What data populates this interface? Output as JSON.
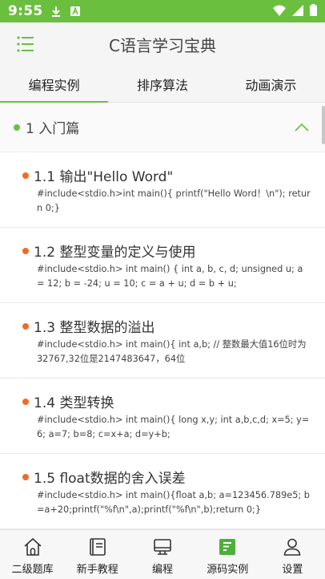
{
  "status_bar": {
    "time": "9:55"
  },
  "app": {
    "title": "C语言学习宝典"
  },
  "tabs": [
    {
      "label": "编程实例",
      "active": true
    },
    {
      "label": "排序算法",
      "active": false
    },
    {
      "label": "动画演示",
      "active": false
    }
  ],
  "section": {
    "title": "1 入门篇",
    "expanded": true
  },
  "items": [
    {
      "title": "1.1 输出\"Hello Word\"",
      "code": "#include<stdio.h>int main(){  printf(\"Hello Word！\\n\");  return 0;}"
    },
    {
      "title": "1.2 整型变量的定义与使用",
      "code": "#include<stdio.h>    int main() {       int a, b, c, d;       unsigned u;       a = 12;       b = -24;       u = 10;       c = a + u;       d = b + u;"
    },
    {
      "title": "1.3 整型数据的溢出",
      "code": "#include<stdio.h>        int main(){  int a,b;  // 整数最大值16位时为32767,32位是2147483647，64位"
    },
    {
      "title": "1.4 类型转换",
      "code": "#include<stdio.h>        int main(){  long x,y;  int a,b,c,d;  x=5;  y=6;  a=7;  b=8;  c=x+a;  d=y+b;"
    },
    {
      "title": "1.5 float数据的舍入误差",
      "code": "#include<stdio.h>        int main(){float a,b; a=123456.789e5; b=a+20;printf(\"%f\\n\",a);printf(\"%f\\n\",b);return 0;}"
    }
  ],
  "bottom_nav": [
    {
      "label": "二级题库",
      "icon": "home-icon",
      "active": false
    },
    {
      "label": "新手教程",
      "icon": "book-icon",
      "active": false
    },
    {
      "label": "编程",
      "icon": "monitor-icon",
      "active": false
    },
    {
      "label": "源码实例",
      "icon": "source-code-icon",
      "active": true
    },
    {
      "label": "设置",
      "icon": "person-icon",
      "active": false
    }
  ],
  "colors": {
    "accent": "#6abf3f",
    "bullet": "#f26a22"
  }
}
